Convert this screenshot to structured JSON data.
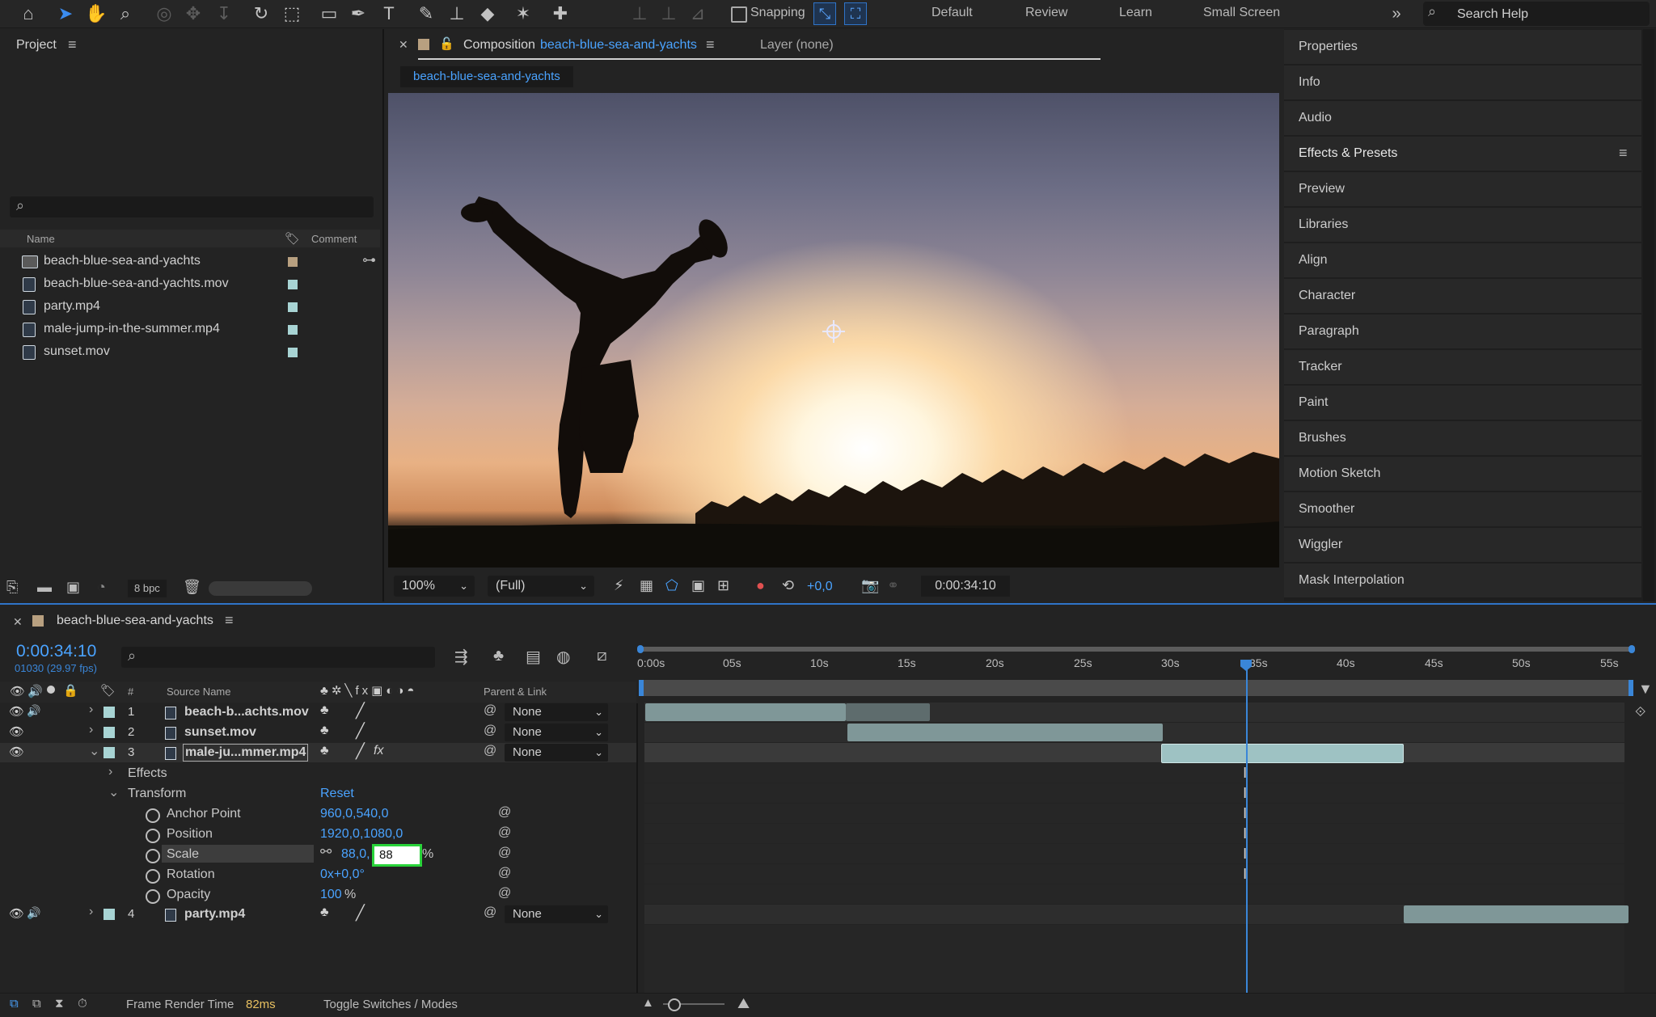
{
  "toolbar": {
    "snapping_label": "Snapping",
    "workspaces": [
      "Default",
      "Review",
      "Learn",
      "Small Screen"
    ],
    "search_placeholder": "Search Help"
  },
  "project": {
    "title": "Project",
    "columns": {
      "name": "Name",
      "comment": "Comment"
    },
    "items": [
      {
        "name": "beach-blue-sea-and-yachts",
        "type": "composition",
        "swatch": "#b8a080"
      },
      {
        "name": "beach-blue-sea-and-yachts.mov",
        "type": "footage",
        "swatch": "#a8d4d4"
      },
      {
        "name": "party.mp4",
        "type": "footage",
        "swatch": "#a8d4d4"
      },
      {
        "name": "male-jump-in-the-summer.mp4",
        "type": "footage",
        "swatch": "#a8d4d4"
      },
      {
        "name": "sunset.mov",
        "type": "footage",
        "swatch": "#a8d4d4"
      }
    ],
    "bpc": "8 bpc"
  },
  "comp": {
    "tab_prefix": "Composition",
    "tab_name": "beach-blue-sea-and-yachts",
    "layer_tab": "Layer (none)",
    "breadcrumb": "beach-blue-sea-and-yachts",
    "zoom": "100%",
    "resolution": "(Full)",
    "exposure": "+0,0",
    "timecode": "0:00:34:10"
  },
  "right_panels": [
    "Properties",
    "Info",
    "Audio",
    "Effects & Presets",
    "Preview",
    "Libraries",
    "Align",
    "Character",
    "Paragraph",
    "Tracker",
    "Paint",
    "Brushes",
    "Motion Sketch",
    "Smoother",
    "Wiggler",
    "Mask Interpolation"
  ],
  "timeline": {
    "comp_name": "beach-blue-sea-and-yachts",
    "timecode": "0:00:34:10",
    "frames": "01030 (29.97 fps)",
    "headers": {
      "num": "#",
      "source": "Source Name",
      "parent": "Parent & Link"
    },
    "ruler": [
      "0:00s",
      "05s",
      "10s",
      "15s",
      "20s",
      "25s",
      "30s",
      "35s",
      "40s",
      "45s",
      "50s",
      "55s"
    ],
    "layers": [
      {
        "num": "1",
        "name": "beach-b...achts.mov",
        "parent": "None"
      },
      {
        "num": "2",
        "name": "sunset.mov",
        "parent": "None"
      },
      {
        "num": "3",
        "name": "male-ju...mmer.mp4",
        "parent": "None"
      },
      {
        "num": "4",
        "name": "party.mp4",
        "parent": "None"
      }
    ],
    "effects_label": "Effects",
    "transform_label": "Transform",
    "reset_label": "Reset",
    "properties": [
      {
        "name": "Anchor Point",
        "value": "960,0,540,0"
      },
      {
        "name": "Position",
        "value": "1920,0,1080,0"
      },
      {
        "name": "Scale",
        "value": "88,0,",
        "input": "88",
        "unit": "%"
      },
      {
        "name": "Rotation",
        "value": "0x+0,0°"
      },
      {
        "name": "Opacity",
        "value": "100",
        "unit": "%"
      }
    ],
    "footer": {
      "render_label": "Frame Render Time",
      "render_value": "82ms",
      "toggle": "Toggle Switches / Modes"
    }
  }
}
